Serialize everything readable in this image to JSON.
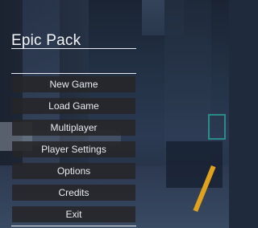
{
  "title": "Epic Pack",
  "menu": {
    "items": [
      {
        "label": "New Game"
      },
      {
        "label": "Load Game"
      },
      {
        "label": "Multiplayer"
      },
      {
        "label": "Player Settings"
      },
      {
        "label": "Options"
      },
      {
        "label": "Credits"
      },
      {
        "label": "Exit"
      }
    ]
  },
  "colors": {
    "text": "#e9ecf1",
    "button_bg": "#262628",
    "accent_teal": "#2aa89a",
    "accent_yellow": "#e0a21c"
  }
}
